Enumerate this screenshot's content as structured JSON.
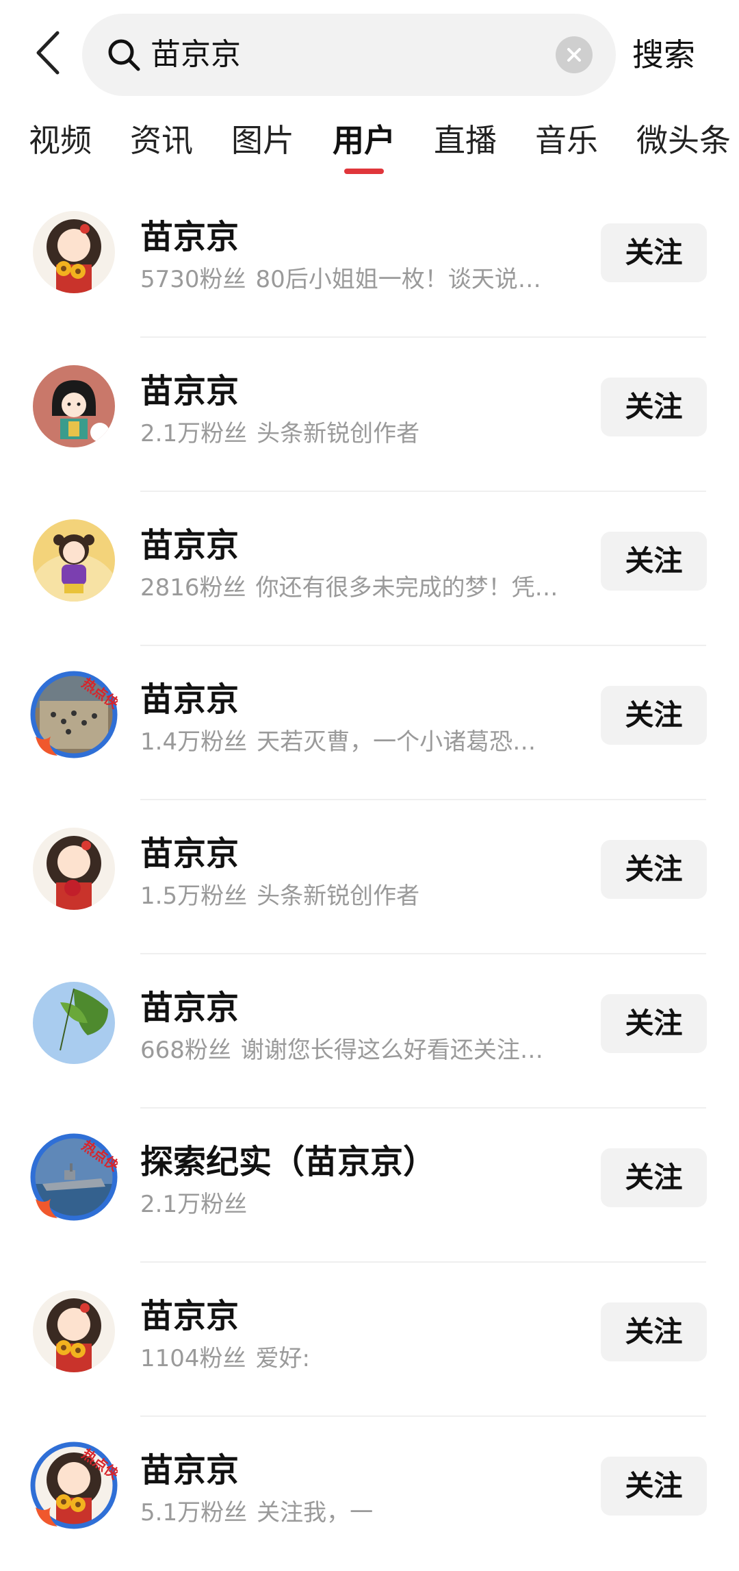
{
  "header": {
    "search_query": "苗京京",
    "search_button": "搜索"
  },
  "tabs": [
    {
      "label": "视频",
      "active": false
    },
    {
      "label": "资讯",
      "active": false
    },
    {
      "label": "图片",
      "active": false
    },
    {
      "label": "用户",
      "active": true
    },
    {
      "label": "直播",
      "active": false
    },
    {
      "label": "音乐",
      "active": false
    },
    {
      "label": "微头条",
      "active": false
    }
  ],
  "users": [
    {
      "name": "苗京京",
      "fans": "5730粉丝",
      "bio": "80后小姐姐一枚！谈天说…",
      "follow": "关注",
      "avatar": "girl-sunflower-avatar",
      "hot_badge": false
    },
    {
      "name": "苗京京",
      "fans": "2.1万粉丝",
      "bio": "头条新锐创作者",
      "follow": "关注",
      "avatar": "cartoon-girl-pink-avatar",
      "hot_badge": false
    },
    {
      "name": "苗京京",
      "fans": "2816粉丝",
      "bio": "你还有很多未完成的梦！凭…",
      "follow": "关注",
      "avatar": "little-girl-avatar",
      "hot_badge": false
    },
    {
      "name": "苗京京",
      "fans": "1.4万粉丝",
      "bio": "天若灭曹，一个小诸葛恐…",
      "follow": "关注",
      "avatar": "crowd-photo-avatar",
      "hot_badge": true
    },
    {
      "name": "苗京京",
      "fans": "1.5万粉丝",
      "bio": "头条新锐创作者",
      "follow": "关注",
      "avatar": "girl-rose-avatar",
      "hot_badge": false
    },
    {
      "name": "苗京京",
      "fans": "668粉丝",
      "bio": "谢谢您长得这么好看还关注…",
      "follow": "关注",
      "avatar": "leaf-sky-avatar",
      "hot_badge": false
    },
    {
      "name": "探索纪实（苗京京）",
      "fans": "2.1万粉丝",
      "bio": "",
      "follow": "关注",
      "avatar": "warship-avatar",
      "hot_badge": true
    },
    {
      "name": "苗京京",
      "fans": "1104粉丝",
      "bio": "爱好:",
      "follow": "关注",
      "avatar": "girl-sunflower-avatar",
      "hot_badge": false
    },
    {
      "name": "苗京京",
      "fans": "5.1万粉丝",
      "bio": "关注我，一",
      "follow": "关注",
      "avatar": "girl-sunflower-avatar",
      "hot_badge": true
    }
  ],
  "hot_badge_text": "热点侠",
  "colors": {
    "accent": "#e0363b",
    "muted_text": "#9a9a9a",
    "button_bg": "#f2f2f2",
    "hot_ring": "#2f6fd6"
  }
}
